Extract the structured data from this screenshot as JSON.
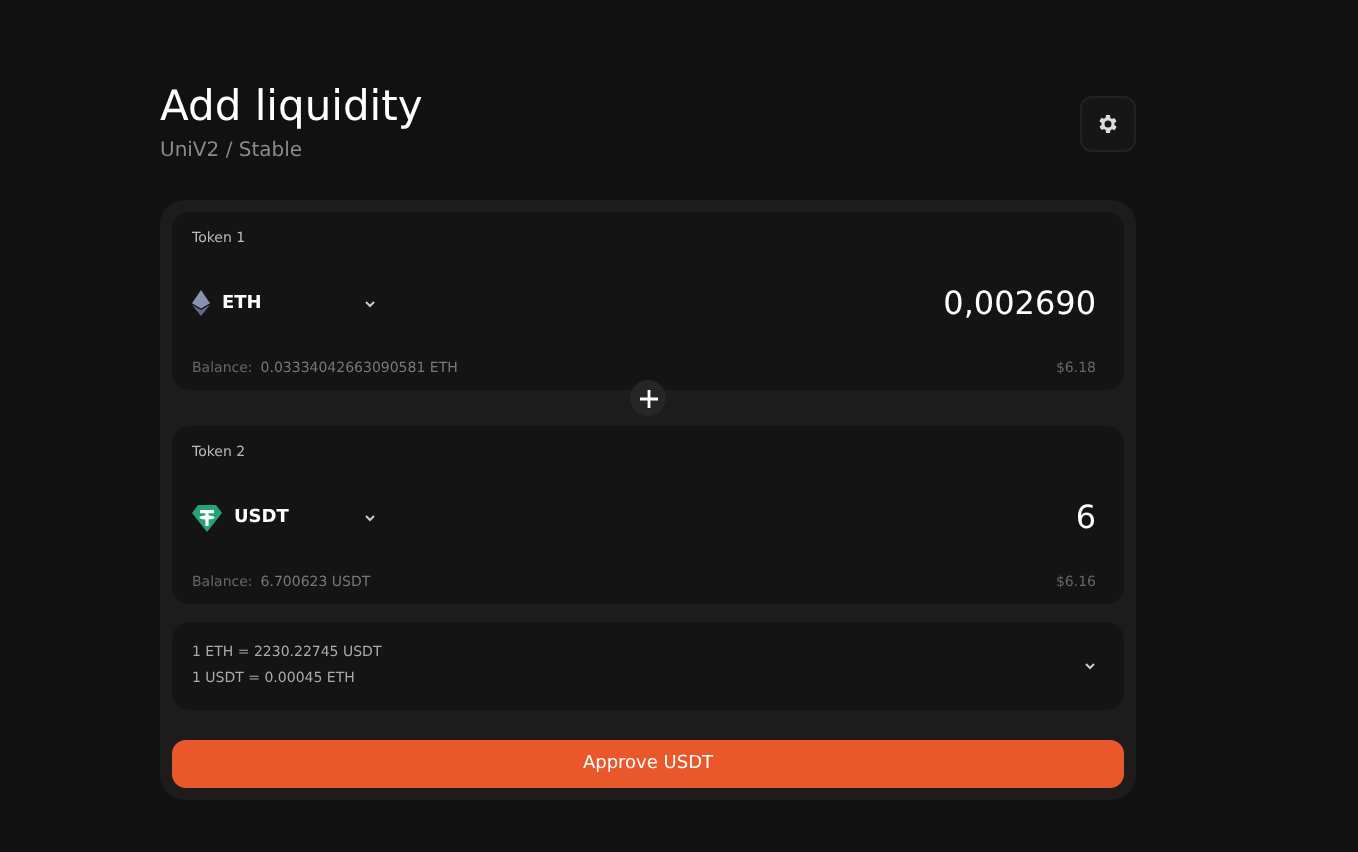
{
  "header": {
    "title": "Add liquidity",
    "subtitle": "UniV2 / Stable"
  },
  "tokens": [
    {
      "label": "Token 1",
      "symbol": "ETH",
      "amount": "0,002690",
      "balance_label": "Balance:",
      "balance": "0.03334042663090581 ETH",
      "usd": "$6.18"
    },
    {
      "label": "Token 2",
      "symbol": "USDT",
      "amount": "6",
      "balance_label": "Balance:",
      "balance": "6.700623 USDT",
      "usd": "$6.16"
    }
  ],
  "rates": [
    "1 ETH = 2230.22745 USDT",
    "1 USDT = 0.00045 ETH"
  ],
  "action_button": "Approve USDT"
}
